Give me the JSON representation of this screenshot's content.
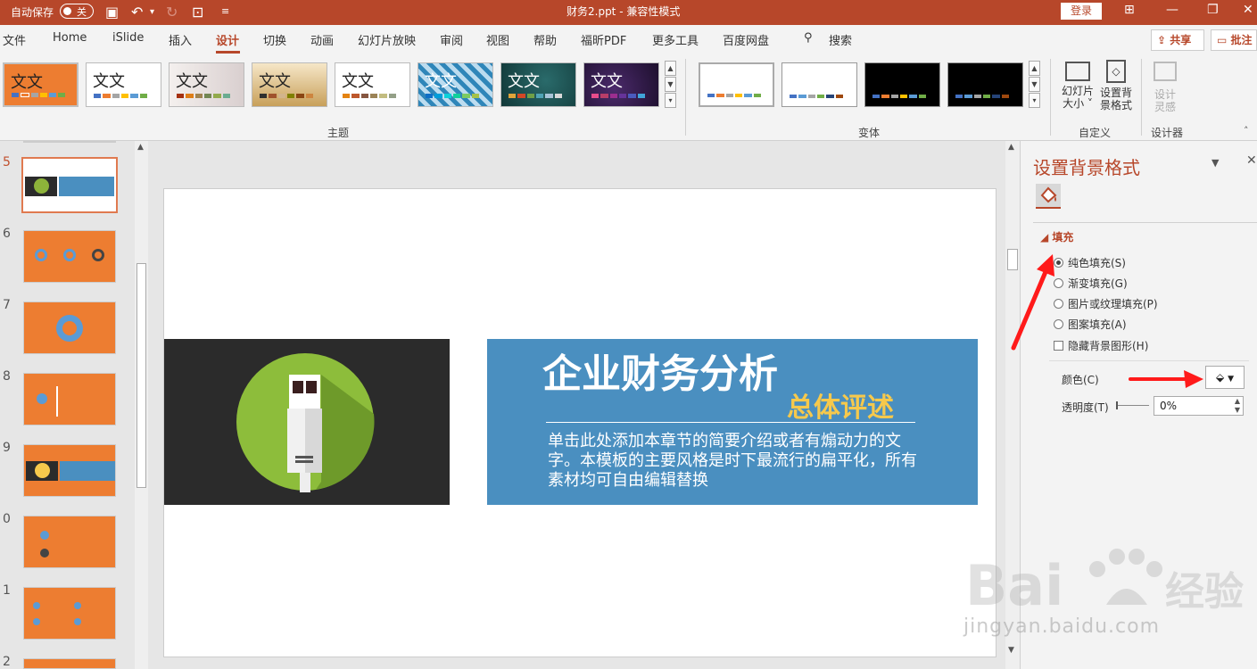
{
  "titlebar": {
    "autosave_label": "自动保存",
    "autosave_state": "关",
    "doc_title": "财务2.ppt  -  兼容性模式",
    "login_label": "登录",
    "bg_color": "#b7472a"
  },
  "menu": {
    "items": [
      "文件",
      "Home",
      "iSlide",
      "插入",
      "设计",
      "切换",
      "动画",
      "幻灯片放映",
      "审阅",
      "视图",
      "帮助",
      "福昕PDF",
      "更多工具",
      "百度网盘",
      "搜索"
    ],
    "active": "设计",
    "share_label": "共享",
    "comment_label": "批注"
  },
  "ribbon": {
    "theme_text": "文文",
    "theme_text_alt": "文文",
    "themes_group_label": "主题",
    "variants_group_label": "变体",
    "customize_group_label": "自定义",
    "designer_group_label": "设计器",
    "slide_size_label_1": "幻灯片",
    "slide_size_label_2": "大小",
    "format_bg_label_1": "设置背",
    "format_bg_label_2": "景格式",
    "design_ideas_label_1": "设计",
    "design_ideas_label_2": "灵感"
  },
  "slides_panel": {
    "numbers": [
      "5",
      "6",
      "7",
      "8",
      "9",
      "0",
      "1",
      "2"
    ],
    "selected": "5"
  },
  "slide": {
    "title": "企业财务分析",
    "subtitle": "总体评述",
    "body": "单击此处添加本章节的简要介绍或者有煽动力的文字。本模板的主要风格是时下最流行的扁平化，所有素材均可自由编辑替换"
  },
  "format_pane": {
    "title": "设置背景格式",
    "section": "填充",
    "options": [
      {
        "label": "纯色填充(S)",
        "selected": true
      },
      {
        "label": "渐变填充(G)",
        "selected": false
      },
      {
        "label": "图片或纹理填充(P)",
        "selected": false
      },
      {
        "label": "图案填充(A)",
        "selected": false
      }
    ],
    "hide_bg_label": "隐藏背景图形(H)",
    "color_label": "颜色(C)",
    "transparency_label": "透明度(T)",
    "transparency_value": "0%"
  },
  "watermark": {
    "text": "jingyan.baidu.com",
    "brand": "经验"
  }
}
